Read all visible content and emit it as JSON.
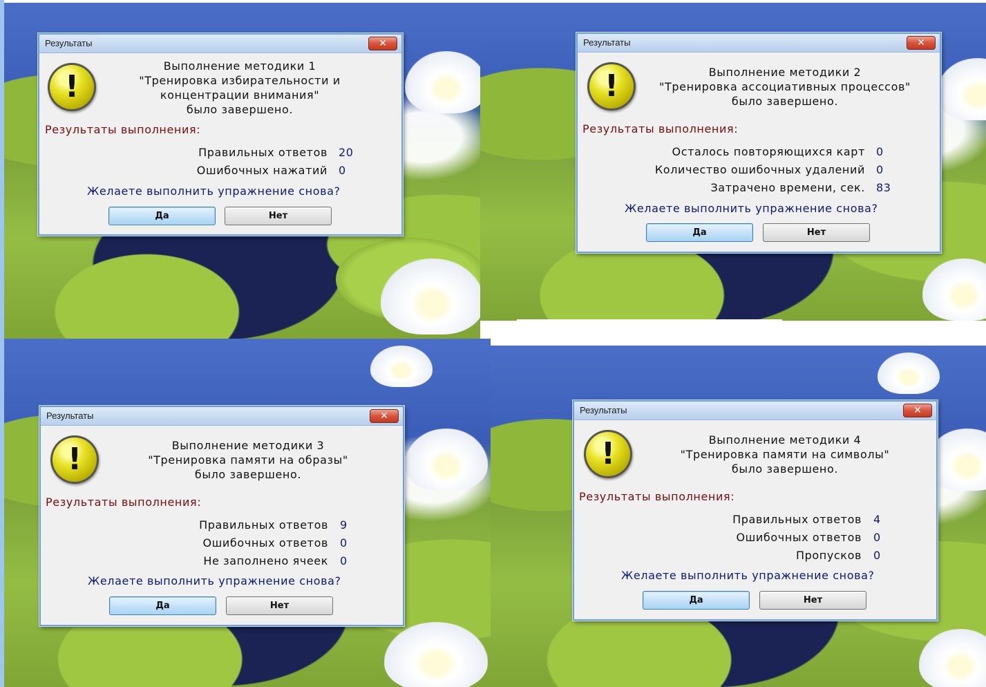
{
  "dialogs": [
    {
      "title": "Результаты",
      "close_glyph": "✕",
      "message_lines": [
        "Выполнение методики 1",
        "\"Тренировка избирательности и",
        "концентрации внимания\"",
        "было завершено."
      ],
      "results_header": "Результаты выполнения:",
      "rows": [
        {
          "label": "Правильных ответов",
          "value": "20"
        },
        {
          "label": "Ошибочных нажатий",
          "value": "0"
        }
      ],
      "question": "Желаете выполнить упражнение снова?",
      "yes_label": "Да",
      "no_label": "Нет"
    },
    {
      "title": "Результаты",
      "close_glyph": "✕",
      "message_lines": [
        "Выполнение методики 2",
        "\"Тренировка ассоциативных процессов\"",
        "было завершено."
      ],
      "results_header": "Результаты выполнения:",
      "rows": [
        {
          "label": "Осталось повторяющихся карт",
          "value": "0"
        },
        {
          "label": "Количество ошибочных удалений",
          "value": "0"
        },
        {
          "label": "Затрачено времени, сек.",
          "value": "83"
        }
      ],
      "question": "Желаете выполнить упражнение снова?",
      "yes_label": "Да",
      "no_label": "Нет"
    },
    {
      "title": "Результаты",
      "close_glyph": "✕",
      "message_lines": [
        "Выполнение методики 3",
        "\"Тренировка памяти на образы\"",
        "было завершено."
      ],
      "results_header": "Результаты выполнения:",
      "rows": [
        {
          "label": "Правильных ответов",
          "value": "9"
        },
        {
          "label": "Ошибочных ответов",
          "value": "0"
        },
        {
          "label": "Не заполнено ячеек",
          "value": "0"
        }
      ],
      "question": "Желаете выполнить упражнение снова?",
      "yes_label": "Да",
      "no_label": "Нет"
    },
    {
      "title": "Результаты",
      "close_glyph": "✕",
      "message_lines": [
        "Выполнение методики 4",
        "\"Тренировка памяти на символы\"",
        "было завершено."
      ],
      "results_header": "Результаты выполнения:",
      "rows": [
        {
          "label": "Правильных ответов",
          "value": "4"
        },
        {
          "label": "Ошибочных ответов",
          "value": "0"
        },
        {
          "label": "Пропусков",
          "value": "0"
        }
      ],
      "question": "Желаете выполнить упражнение снова?",
      "yes_label": "Да",
      "no_label": "Нет"
    }
  ],
  "icons": {
    "warning": "warning-icon",
    "close": "close-icon"
  },
  "colors": {
    "results_header": "#7a0b0b",
    "value_text": "#0a1a7a",
    "question_text": "#0a1a7a",
    "dialog_bg": "#f0f0f0"
  }
}
